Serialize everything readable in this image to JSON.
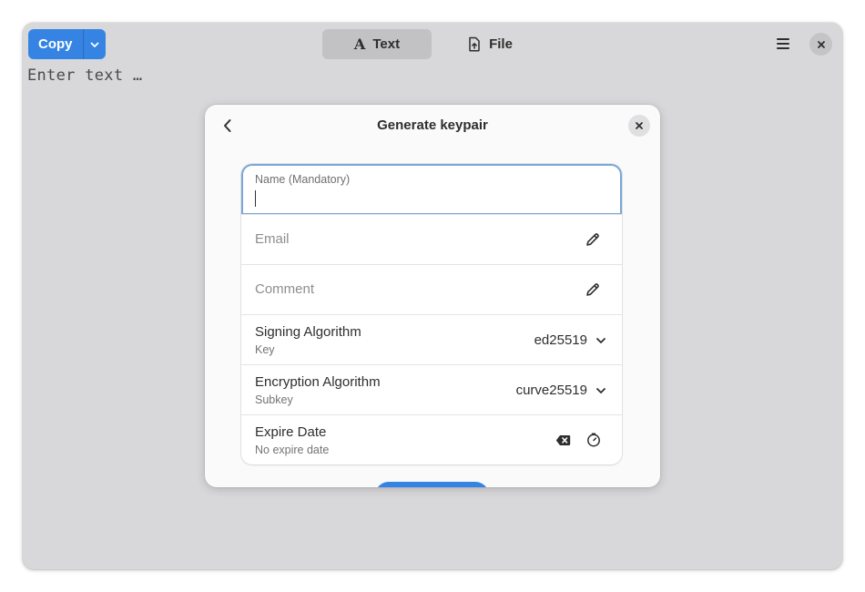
{
  "header": {
    "copy_label": "Copy",
    "modes": [
      {
        "label": "Text",
        "icon": "text-format-icon",
        "active": true
      },
      {
        "label": "File",
        "icon": "file-upload-icon",
        "active": false
      }
    ]
  },
  "editor": {
    "placeholder": "Enter text …"
  },
  "dialog": {
    "title": "Generate keypair",
    "name_field": {
      "label": "Name (Mandatory)",
      "value": ""
    },
    "email_field": {
      "placeholder": "Email"
    },
    "comment_field": {
      "placeholder": "Comment"
    },
    "signing": {
      "title": "Signing Algorithm",
      "subtitle": "Key",
      "value": "ed25519"
    },
    "encryption": {
      "title": "Encryption Algorithm",
      "subtitle": "Subkey",
      "value": "curve25519"
    },
    "expire": {
      "title": "Expire Date",
      "subtitle": "No expire date"
    }
  },
  "colors": {
    "accent": "#3584e4",
    "focus_ring": "#7aa6d9",
    "window_bg": "#d8d8da",
    "dialog_bg": "#fafafa"
  }
}
